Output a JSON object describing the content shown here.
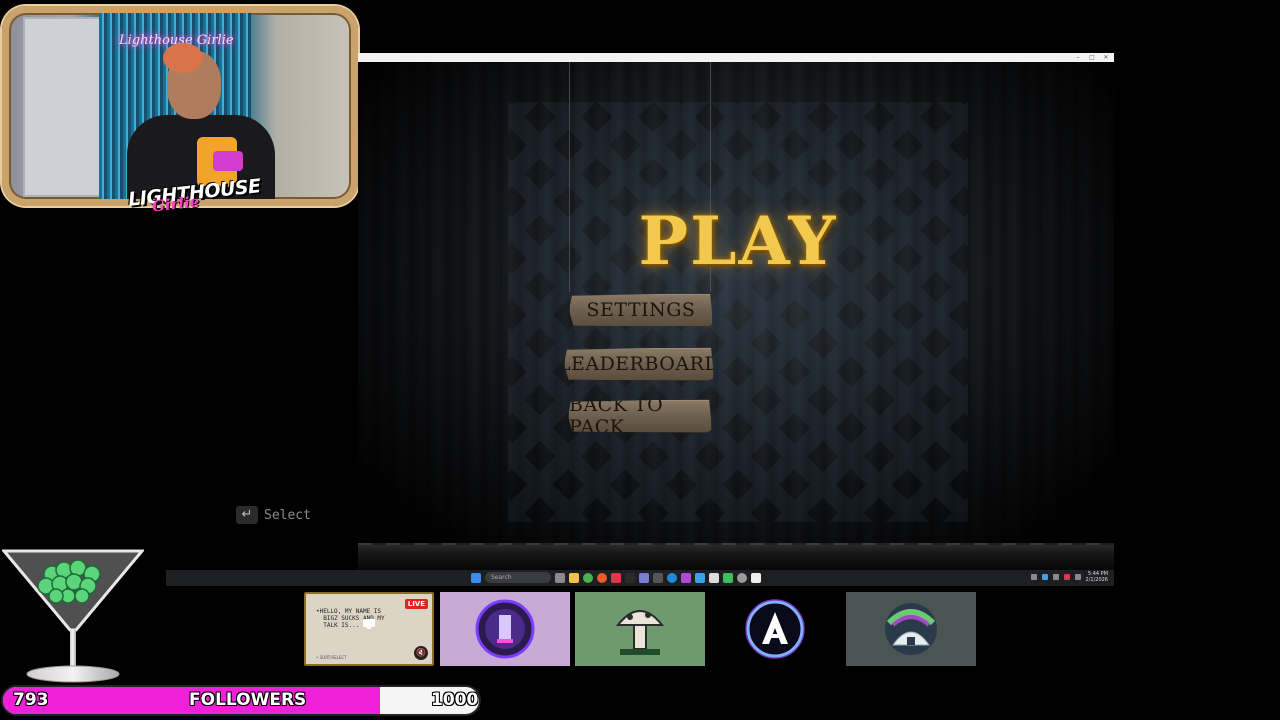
{
  "game": {
    "title": "PLAY",
    "menu": [
      "SETTINGS",
      "LEADERBOARD",
      "BACK TO PACK"
    ],
    "select_hint": "Select",
    "enter_icon": "enter-key-icon"
  },
  "window_controls": {
    "minimize": "–",
    "maximize": "□",
    "close": "✕"
  },
  "taskbar": {
    "search_label": "Search",
    "time": "5:44 PM",
    "date": "2/1/2026"
  },
  "webcam": {
    "neon_sign": "Lighthouse Girlie",
    "logo_main": "LIGHTHOUSE",
    "logo_sub": "Girlie"
  },
  "followers": {
    "current": "793",
    "label": "FOLLOWERS",
    "goal": "1000",
    "progress": 0.793,
    "fill_color": "#f01fd8"
  },
  "tiles": {
    "chat_text": "•HELLO, MY NAME IS\n  BIGZ SUCKS AND MY\n  TALK IS...",
    "live_badge": "LIVE",
    "chat_footer": "• SORT/SELECT"
  },
  "colors": {
    "title_gold": "#f2c94c",
    "button_wood": "#6e604e",
    "webcam_frame": "#c9a36b",
    "accent_pink": "#f01fd8"
  }
}
